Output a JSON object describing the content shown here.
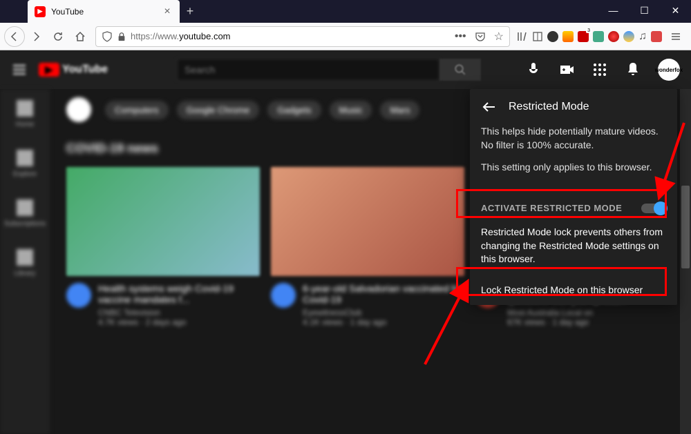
{
  "browser": {
    "tab_title": "YouTube",
    "url_prefix": "https://www.",
    "url_domain": "youtube.com",
    "url_suffix": ""
  },
  "youtube": {
    "logo_text": "YouTube",
    "search_placeholder": "Search",
    "avatar_text": "wonderfox",
    "section_title": "COVID-19 news",
    "chips": [
      "Computers",
      "Google Chrome",
      "Gadgets",
      "Music",
      "Mars"
    ]
  },
  "restricted_mode": {
    "title": "Restricted Mode",
    "description": "This helps hide potentially mature videos. No filter is 100% accurate.",
    "browser_note": "This setting only applies to this browser.",
    "toggle_label": "ACTIVATE RESTRICTED MODE",
    "toggle_on": true,
    "lock_description": "Restricted Mode lock prevents others from changing the Restricted Mode settings on this browser.",
    "lock_action": "Lock Restricted Mode on this browser"
  }
}
